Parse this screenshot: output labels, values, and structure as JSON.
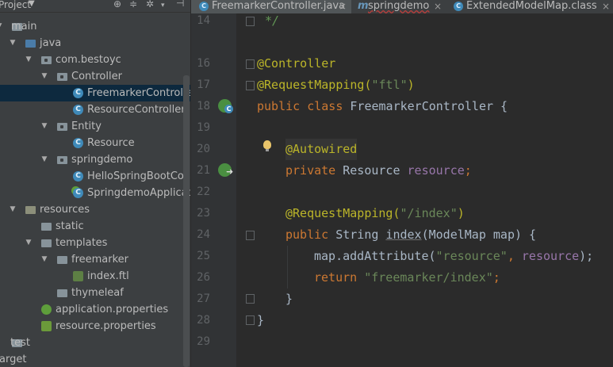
{
  "project_panel": {
    "title": "Project",
    "tree": [
      {
        "label": "main",
        "icon": "folder-icon",
        "depth": 0,
        "expanded": true
      },
      {
        "label": "java",
        "icon": "source-folder-icon",
        "depth": 1,
        "expanded": true
      },
      {
        "label": "com.bestoyc",
        "icon": "package-icon",
        "depth": 2,
        "expanded": true
      },
      {
        "label": "Controller",
        "icon": "package-icon",
        "depth": 3,
        "expanded": true
      },
      {
        "label": "FreemarkerController",
        "icon": "class-icon",
        "depth": 4,
        "selected": true
      },
      {
        "label": "ResourceController",
        "icon": "class-icon",
        "depth": 4
      },
      {
        "label": "Entity",
        "icon": "package-icon",
        "depth": 3,
        "expanded": true
      },
      {
        "label": "Resource",
        "icon": "class-icon",
        "depth": 4
      },
      {
        "label": "springdemo",
        "icon": "package-icon",
        "depth": 3,
        "expanded": true
      },
      {
        "label": "HelloSpringBootControlle",
        "icon": "class-icon",
        "depth": 4
      },
      {
        "label": "SpringdemoApplication",
        "icon": "spring-class-icon",
        "depth": 4
      },
      {
        "label": "resources",
        "icon": "resources-folder-icon",
        "depth": 1,
        "expanded": true
      },
      {
        "label": "static",
        "icon": "folder-icon",
        "depth": 2
      },
      {
        "label": "templates",
        "icon": "folder-icon",
        "depth": 2,
        "expanded": true
      },
      {
        "label": "freemarker",
        "icon": "folder-icon",
        "depth": 3,
        "expanded": true
      },
      {
        "label": "index.ftl",
        "icon": "ftl-file-icon",
        "depth": 4
      },
      {
        "label": "thymeleaf",
        "icon": "folder-icon",
        "depth": 3
      },
      {
        "label": "application.properties",
        "icon": "spring-properties-icon",
        "depth": 2
      },
      {
        "label": "resource.properties",
        "icon": "properties-file-icon",
        "depth": 2
      },
      {
        "label": "test",
        "icon": "folder-icon",
        "depth": 0
      },
      {
        "label": "arget",
        "icon": "",
        "depth": 0
      }
    ]
  },
  "tabs": [
    {
      "label": "FreemarkerController.java",
      "icon": "class-icon",
      "active": true,
      "close": "×"
    },
    {
      "label": "springdemo",
      "icon": "maven-icon",
      "active": false,
      "close": "×"
    },
    {
      "label": "ExtendedModelMap.class",
      "icon": "class-icon",
      "active": false,
      "close": "×"
    }
  ],
  "editor": {
    "line_numbers": [
      "14",
      "16",
      "17",
      "18",
      "19",
      "20",
      "21",
      "22",
      "23",
      "24",
      "25",
      "26",
      "27",
      "28",
      "29"
    ],
    "lines": {
      "l14": "*/",
      "l16": "@Controller",
      "l17a": "@RequestMapping(",
      "l17b": "\"ftl\"",
      "l17c": ")",
      "l18a": "public class ",
      "l18b": "FreemarkerController {",
      "l20": "@Autowired",
      "l21a": "private ",
      "l21b": "Resource ",
      "l21c": "resource",
      "l21d": ";",
      "l23a": "@RequestMapping(",
      "l23b": "\"/index\"",
      "l23c": ")",
      "l24a": "public ",
      "l24b": "String ",
      "l24c": "index",
      "l24d": "(ModelMap map) {",
      "l25a": "map.addAttribute(",
      "l25b": "\"resource\"",
      "l25c": ", ",
      "l25d": "resource",
      "l25e": ");",
      "l26a": "return ",
      "l26b": "\"freemarker/index\"",
      "l26c": ";",
      "l27": "}",
      "l28": "}"
    }
  }
}
